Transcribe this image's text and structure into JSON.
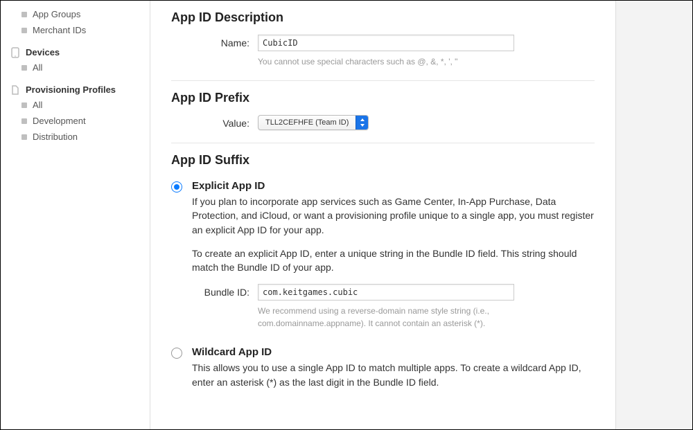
{
  "sidebar": {
    "topitems": [
      {
        "label": "App Groups"
      },
      {
        "label": "Merchant IDs"
      }
    ],
    "devices": {
      "heading": "Devices",
      "items": [
        {
          "label": "All"
        }
      ]
    },
    "provisioning": {
      "heading": "Provisioning Profiles",
      "items": [
        {
          "label": "All"
        },
        {
          "label": "Development"
        },
        {
          "label": "Distribution"
        }
      ]
    }
  },
  "description": {
    "heading": "App ID Description",
    "name_label": "Name:",
    "name_value": "CubicID",
    "name_help": "You cannot use special characters such as @, &, *, ', \""
  },
  "prefix": {
    "heading": "App ID Prefix",
    "value_label": "Value:",
    "selected": "TLL2CEFHFE (Team ID)"
  },
  "suffix": {
    "heading": "App ID Suffix",
    "explicit": {
      "title": "Explicit App ID",
      "desc1": "If you plan to incorporate app services such as Game Center, In-App Purchase, Data Protection, and iCloud, or want a provisioning profile unique to a single app, you must register an explicit App ID for your app.",
      "desc2": "To create an explicit App ID, enter a unique string in the Bundle ID field. This string should match the Bundle ID of your app.",
      "bundle_label": "Bundle ID:",
      "bundle_value": "com.keitgames.cubic",
      "bundle_help": "We recommend using a reverse-domain name style string (i.e., com.domainname.appname). It cannot contain an asterisk (*)."
    },
    "wildcard": {
      "title": "Wildcard App ID",
      "desc1": "This allows you to use a single App ID to match multiple apps. To create a wildcard App ID, enter an asterisk (*) as the last digit in the Bundle ID field."
    }
  }
}
